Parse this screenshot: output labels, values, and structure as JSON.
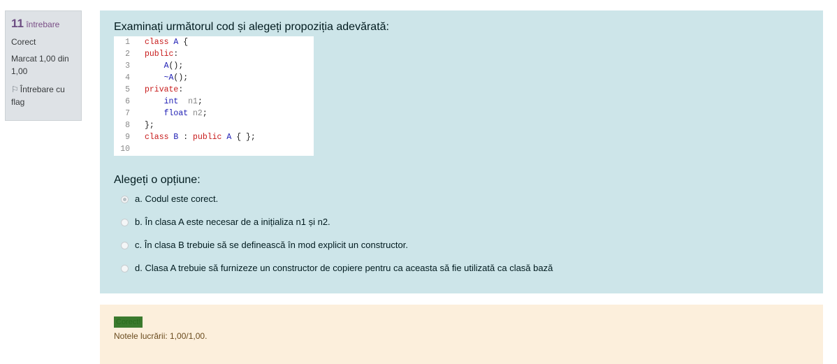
{
  "info": {
    "number": "11",
    "label": "întrebare",
    "state": "Corect",
    "mark": "Marcat 1,00 din 1,00",
    "flag_icon": "flag-icon",
    "flag_label": "Întrebare cu flag"
  },
  "question": {
    "text": "Examinați următorul cod și alegeți propoziția adevărată:",
    "code_lines": [
      {
        "n": "1",
        "code": "class A {"
      },
      {
        "n": "2",
        "code": "public:"
      },
      {
        "n": "3",
        "code": "    A();"
      },
      {
        "n": "4",
        "code": "    ~A();"
      },
      {
        "n": "5",
        "code": "private:"
      },
      {
        "n": "6",
        "code": "    int  n1;"
      },
      {
        "n": "7",
        "code": "    float n2;"
      },
      {
        "n": "8",
        "code": "};"
      },
      {
        "n": "9",
        "code": "class B : public A { };"
      },
      {
        "n": "10",
        "code": ""
      }
    ],
    "prompt": "Alegeți o opțiune:",
    "options": [
      {
        "label": "a. Codul este corect.",
        "selected": true
      },
      {
        "label": "b. În clasa A este necesar de a inițializa n1 și n2.",
        "selected": false
      },
      {
        "label": "c. În clasa B trebuie să se definească în mod explicit un constructor.",
        "selected": false
      },
      {
        "label": "d. Clasa A trebuie să furnizeze un constructor de copiere pentru ca aceasta să fie utilizată ca clasă bază",
        "selected": false
      }
    ]
  },
  "feedback": {
    "badge": "Corect!",
    "grade": "Notele lucrării: 1,00/1,00."
  },
  "colors": {
    "info_bg": "#dee2e6",
    "content_bg": "#cde5e9",
    "feedback_bg": "#fcefdc",
    "badge_bg": "#3b7a2e",
    "keyword": "#c71b1b",
    "type": "#1b1bb3"
  }
}
